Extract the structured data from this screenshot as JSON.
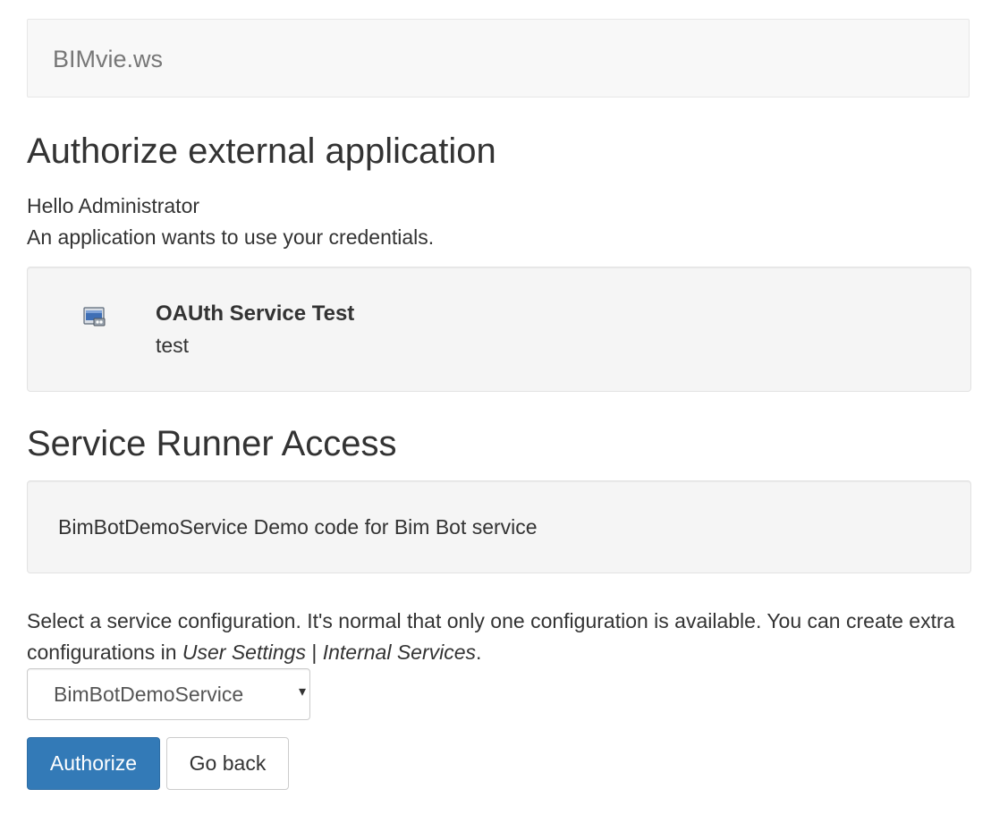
{
  "navbar": {
    "brand": "BIMvie.ws"
  },
  "page": {
    "title": "Authorize external application",
    "greeting": "Hello Administrator",
    "request_message": "An application wants to use your credentials."
  },
  "application": {
    "icon": "application-window-icon",
    "name": "OAUth Service Test",
    "description": "test"
  },
  "service_runner": {
    "title": "Service Runner Access",
    "service_name": "BimBotDemoService",
    "service_description": "Demo code for Bim Bot service"
  },
  "configuration": {
    "instruction_prefix": "Select a service configuration. It's normal that only one configuration is available. You can create extra configurations in ",
    "link_user_settings": "User Settings",
    "separator": " | ",
    "link_internal_services": "Internal Services",
    "instruction_suffix": ".",
    "selected_value": "BimBotDemoService",
    "arrow_icon": "▾"
  },
  "actions": {
    "authorize_label": "Authorize",
    "go_back_label": "Go back"
  },
  "colors": {
    "primary": "#337ab7",
    "navbar_bg": "#f8f8f8",
    "well_bg": "#f5f5f5"
  }
}
